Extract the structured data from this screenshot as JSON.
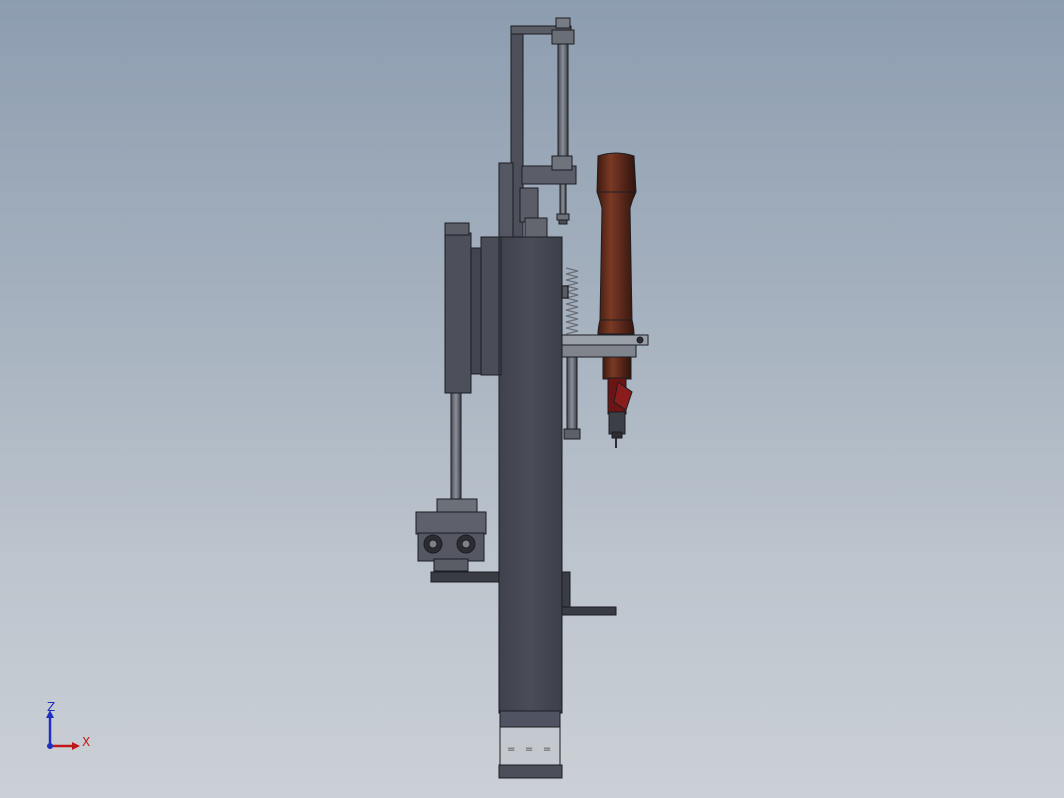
{
  "triad": {
    "z_label": "Z",
    "x_label": "X",
    "z_color": "#1f2fbf",
    "x_color": "#c01818"
  },
  "model": {
    "frame_color": "#474a55",
    "edge_color": "#1c1d22",
    "cylinder_color": "#5e2a1c",
    "nozzle_color": "#6b1414",
    "bracket_color": "#9aa0a8"
  }
}
